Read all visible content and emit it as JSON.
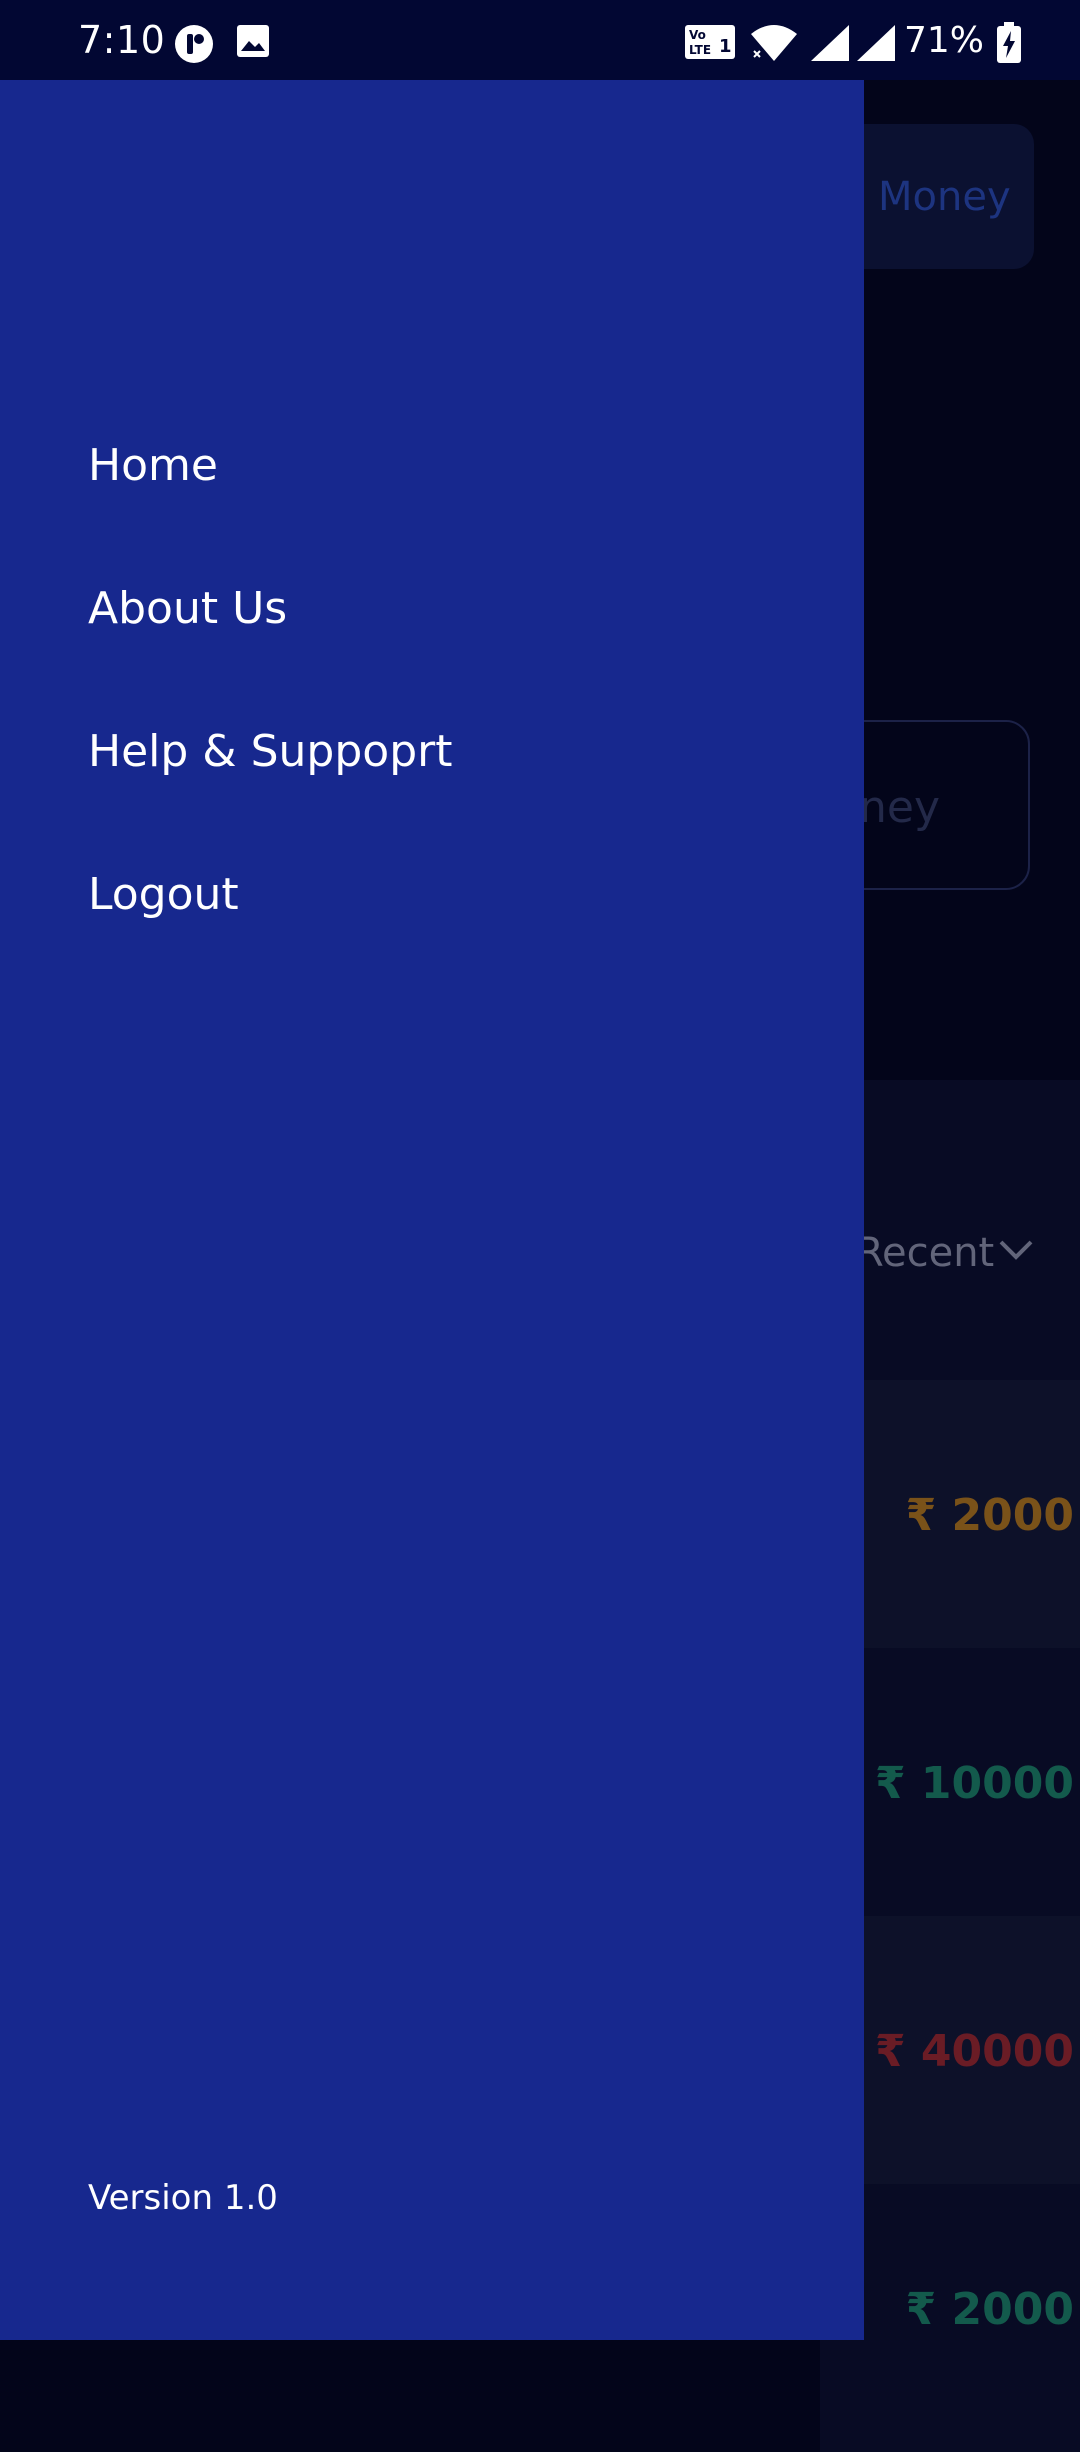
{
  "status_bar": {
    "time": "7:10",
    "battery_percent": "71%",
    "icons": [
      "app-notification-icon",
      "image-notification-icon",
      "volte-icon",
      "wifi-icon",
      "signal-icon",
      "signal-icon-2",
      "battery-charging-icon"
    ]
  },
  "drawer": {
    "items": [
      {
        "label": "Home"
      },
      {
        "label": "About Us"
      },
      {
        "label": "Help & Suppoprt"
      },
      {
        "label": "Logout"
      }
    ],
    "version": "Version 1.0",
    "background_color": "#17288e"
  },
  "background": {
    "money_button_label": "Money",
    "outline_button_label": "ney",
    "sort_label": "Recent",
    "rows": [
      {
        "amount": "₹ 2000",
        "color": "#7a5219"
      },
      {
        "amount": "₹ 10000",
        "color": "#135a4c"
      },
      {
        "amount": "₹ 40000",
        "color": "#6a1c25"
      },
      {
        "amount": "₹ 2000",
        "color": "#135a4c"
      }
    ]
  }
}
